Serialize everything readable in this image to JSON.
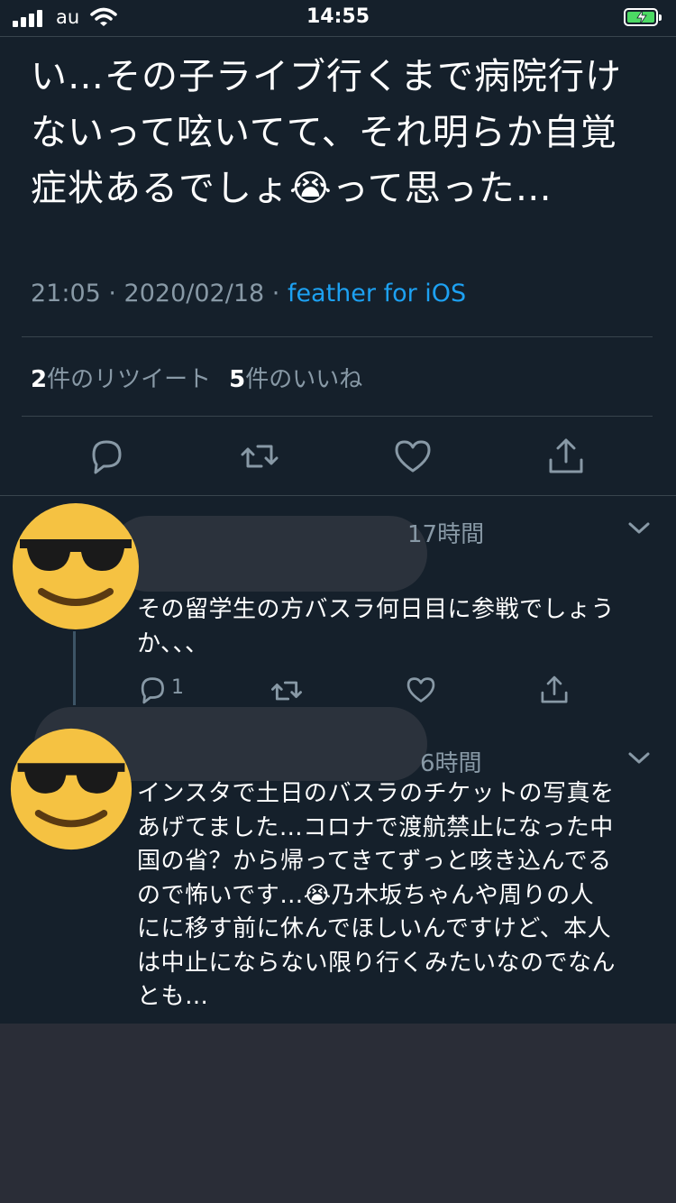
{
  "status_bar": {
    "carrier": "au",
    "time": "14:55"
  },
  "tweet": {
    "text": "い…その子ライブ行くまで病院行け\nないって呟いてて、それ明らか自覚\n症状あるでしょ😭って思った…",
    "time_date": "21:05 · 2020/02/18 · ",
    "source": "feather for iOS",
    "retweet_count": "2",
    "retweet_label": "件のリツイート",
    "like_count": "5",
    "like_label": "件のいいね"
  },
  "replies": [
    {
      "time": "17時間",
      "text": "その留学生の方バスラ何日目に参戦でしょう\nか、、、",
      "reply_count": "1"
    },
    {
      "time": "6時間",
      "text": "インスタで土日のバスラのチケットの写真を\nあげてました…コロナで渡航禁止になった中\n国の省？から帰ってきてずっと咳き込んでる\nので怖いです…😭乃木坂ちゃんや周りの人\nにに移す前に休んでほしいんですけど、本人\nは中止にならない限り行くみたいなのでなん\nとも…"
    }
  ],
  "colors": {
    "background": "#15202b",
    "divider": "#38444d",
    "muted_text": "#8899a6",
    "link": "#1da1f2",
    "battery_charging": "#4cd964",
    "avatar_face": "#f5c242"
  },
  "icons": [
    "signal-icon",
    "wifi-icon",
    "battery-charging-icon",
    "reply-icon",
    "retweet-icon",
    "like-icon",
    "share-icon",
    "chevron-down-icon",
    "sunglasses-emoji-avatar"
  ]
}
